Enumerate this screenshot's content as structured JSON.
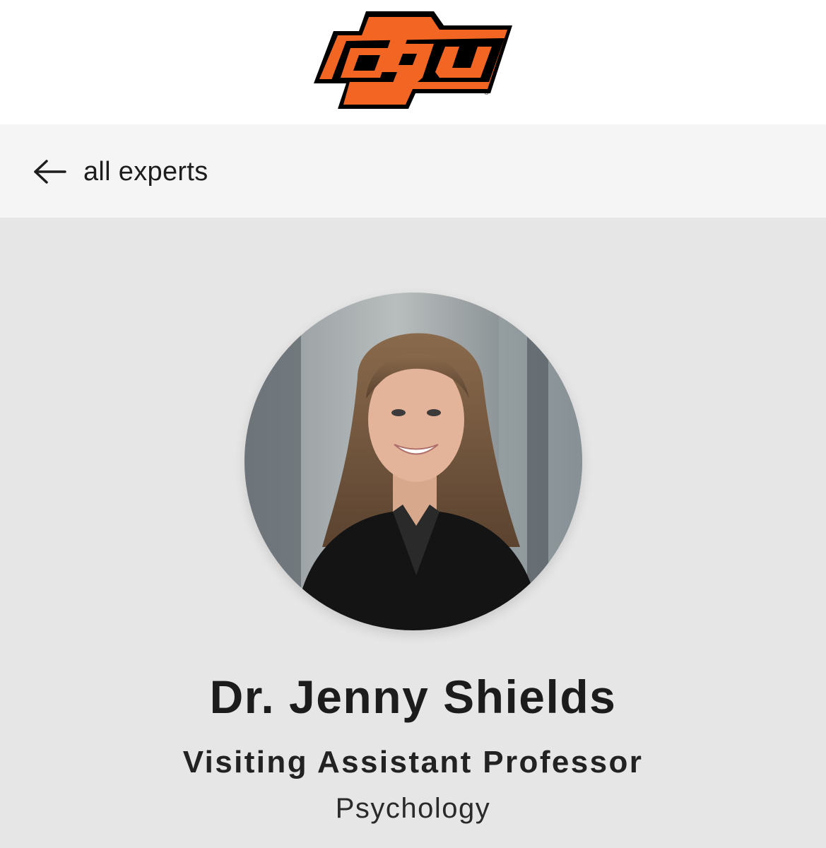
{
  "header": {
    "logo": {
      "text": "OSU",
      "icon": "osu-brand-logo",
      "registered_mark": "®",
      "colors": {
        "primary": "#f26522",
        "outline": "#000000"
      }
    }
  },
  "nav": {
    "back_label": "all experts",
    "back_icon": "arrow-left-icon"
  },
  "profile": {
    "photo_icon": "avatar",
    "name": "Dr. Jenny Shields",
    "title": "Visiting Assistant Professor",
    "department": "Psychology"
  },
  "colors": {
    "header_bg": "#ffffff",
    "nav_bg": "#f5f5f5",
    "page_bg": "#e6e6e6",
    "text": "#1d1d1d"
  }
}
